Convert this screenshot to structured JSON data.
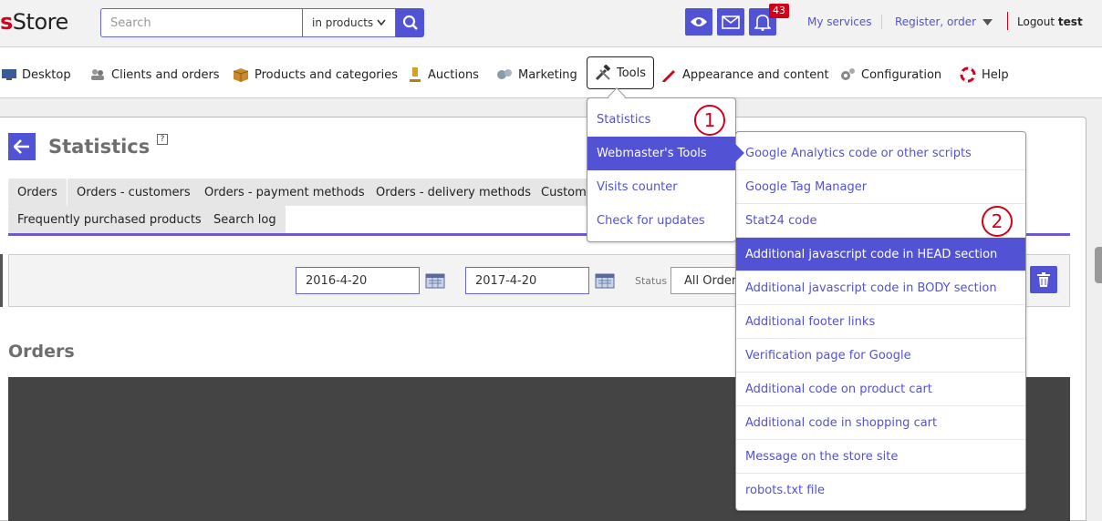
{
  "app": {
    "logo_prefix": "s",
    "logo_rest": "Store"
  },
  "search": {
    "placeholder": "Search",
    "scope": "in products"
  },
  "notifications": {
    "count": "43"
  },
  "toplinks": {
    "my_services": "My services",
    "register_order": "Register, order",
    "logout_label": "Logout",
    "logout_user": "test"
  },
  "nav": {
    "items": [
      {
        "label": "Desktop",
        "icon": "desktop-icon"
      },
      {
        "label": "Clients and orders",
        "icon": "clients-icon"
      },
      {
        "label": "Products and categories",
        "icon": "box-icon"
      },
      {
        "label": "Auctions",
        "icon": "gavel-icon"
      },
      {
        "label": "Marketing",
        "icon": "marketing-icon"
      },
      {
        "label": "Tools",
        "icon": "tools-icon"
      },
      {
        "label": "Appearance and content",
        "icon": "pencil-icon"
      },
      {
        "label": "Configuration",
        "icon": "gears-icon"
      },
      {
        "label": "Help",
        "icon": "lifebuoy-icon"
      }
    ]
  },
  "page": {
    "title": "Statistics",
    "help": "?",
    "tabs": [
      "Orders",
      "Orders - customers",
      "Orders - payment methods",
      "Orders - delivery methods",
      "Custome",
      "Frequently purchased products",
      "Search log"
    ],
    "filters": {
      "date_from": "2016-4-20",
      "date_to": "2017-4-20",
      "status_label": "Status",
      "status_value": "All Orders"
    },
    "section_title": "Orders"
  },
  "tools_menu": {
    "items": [
      "Statistics",
      "Webmaster's Tools",
      "Visits counter",
      "Check for updates"
    ],
    "active": "Webmaster's Tools"
  },
  "webmaster_menu": {
    "items": [
      "Google Analytics code or other scripts",
      "Google Tag Manager",
      "Stat24 code",
      "Additional javascript code in HEAD section",
      "Additional javascript code in BODY section",
      "Additional footer links",
      "Verification page for Google",
      "Additional code on product cart",
      "Additional code in shopping cart",
      "Message on the store site",
      "robots.txt file"
    ],
    "active": "Additional javascript code in HEAD section"
  },
  "markers": [
    "1",
    "2"
  ],
  "colors": {
    "accent": "#5252d4",
    "brand_red": "#d0021b",
    "tab_underline": "#6a5acd"
  }
}
